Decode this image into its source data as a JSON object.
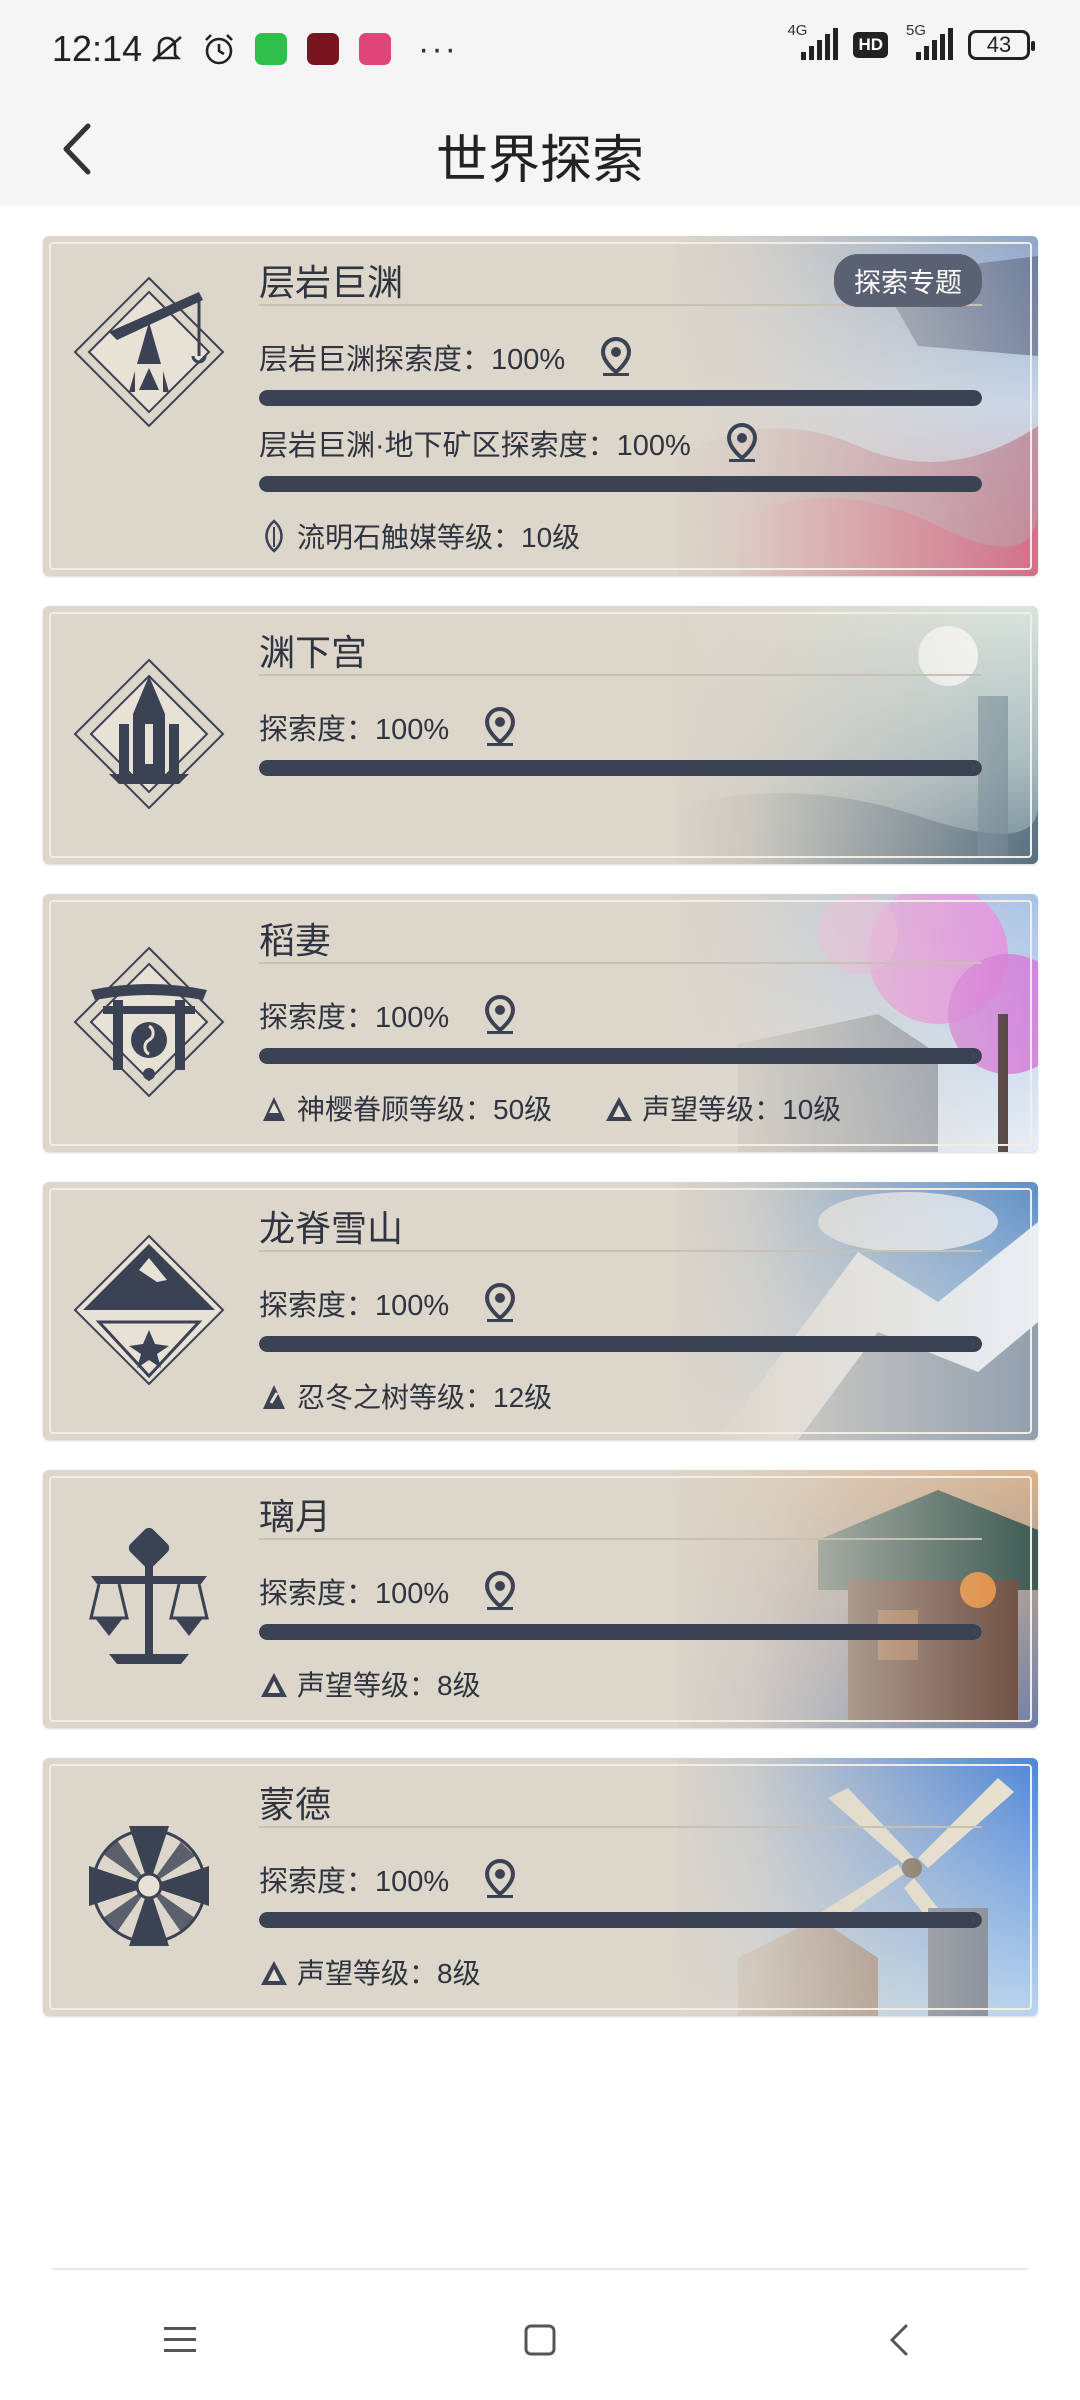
{
  "status_bar": {
    "time": "12:14",
    "icons_left": [
      "mute-icon",
      "alarm-icon",
      "wechat-icon",
      "app-red-icon",
      "app-pink-icon"
    ],
    "more": "···",
    "net_4g": "4G",
    "hd": "HD",
    "net_5g": "5G",
    "battery": "43"
  },
  "header": {
    "title": "世界探索",
    "back_icon": "chevron-left-icon"
  },
  "cards": [
    {
      "name": "层岩巨渊",
      "tag": "探索专题",
      "stats": [
        {
          "label": "层岩巨渊探索度：100%",
          "progress": 1.0
        },
        {
          "label": "层岩巨渊·地下矿区探索度：100%",
          "progress": 1.0
        }
      ],
      "levels": [
        "流明石触媒等级：10级"
      ]
    },
    {
      "name": "渊下宫",
      "stats": [
        {
          "label": "探索度：100%",
          "progress": 1.0
        }
      ],
      "levels": []
    },
    {
      "name": "稻妻",
      "stats": [
        {
          "label": "探索度：100%",
          "progress": 1.0
        }
      ],
      "levels": [
        "神樱眷顾等级：50级",
        "声望等级：10级"
      ]
    },
    {
      "name": "龙脊雪山",
      "stats": [
        {
          "label": "探索度：100%",
          "progress": 1.0
        }
      ],
      "levels": [
        "忍冬之树等级：12级"
      ]
    },
    {
      "name": "璃月",
      "stats": [
        {
          "label": "探索度：100%",
          "progress": 1.0
        }
      ],
      "levels": [
        "声望等级：8级"
      ]
    },
    {
      "name": "蒙德",
      "stats": [
        {
          "label": "探索度：100%",
          "progress": 1.0
        }
      ],
      "levels": [
        "声望等级：8级"
      ]
    }
  ],
  "colors": {
    "card_bg": "#ddd6ca",
    "bar_fill": "#3b4254",
    "tag_bg": "#5a6173",
    "text": "#2f3440"
  },
  "navbar": [
    "menu-icon",
    "home-square-icon",
    "back-icon"
  ]
}
